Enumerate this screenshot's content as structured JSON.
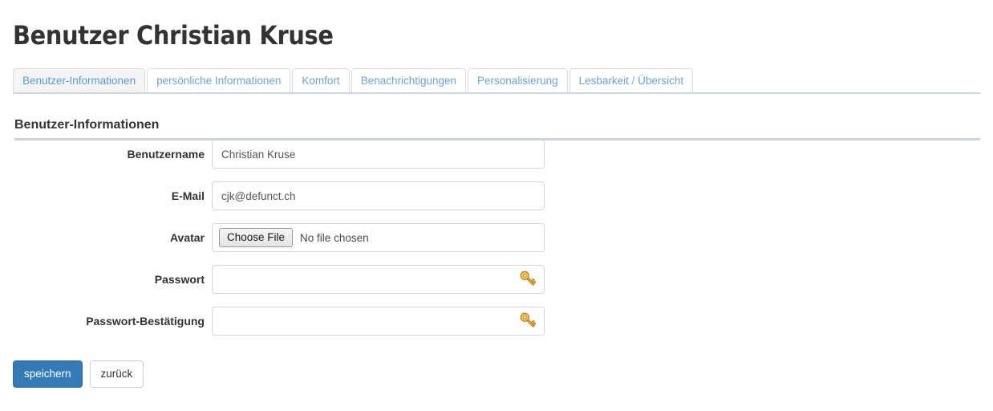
{
  "page": {
    "title": "Benutzer Christian Kruse"
  },
  "tabs": {
    "items": [
      {
        "label": "Benutzer-Informationen",
        "active": true
      },
      {
        "label": "persönliche Informationen",
        "active": false
      },
      {
        "label": "Komfort",
        "active": false
      },
      {
        "label": "Benachrichtigungen",
        "active": false
      },
      {
        "label": "Personalisierung",
        "active": false
      },
      {
        "label": "Lesbarkeit / Übersicht",
        "active": false
      }
    ]
  },
  "section": {
    "heading": "Benutzer-Informationen"
  },
  "form": {
    "username": {
      "label": "Benutzername",
      "value": "Christian Kruse",
      "placeholder": ""
    },
    "email": {
      "label": "E-Mail",
      "value": "cjk@defunct.ch",
      "placeholder": ""
    },
    "avatar": {
      "label": "Avatar",
      "button_label": "Choose File",
      "status": "No file chosen"
    },
    "password": {
      "label": "Passwort",
      "value": "",
      "placeholder": "",
      "icon": "key-icon"
    },
    "password_confirmation": {
      "label": "Passwort-Bestätigung",
      "value": "",
      "placeholder": "",
      "icon": "key-icon"
    }
  },
  "buttons": {
    "submit": "speichern",
    "back": "zurück"
  },
  "colors": {
    "primary": "#337ab7",
    "primary_border": "#2e6da4",
    "tab_link": "#6ba3d6",
    "rule": "#cbd6df",
    "input_border": "#d4d4d4",
    "key_gold": "#f0c419"
  }
}
